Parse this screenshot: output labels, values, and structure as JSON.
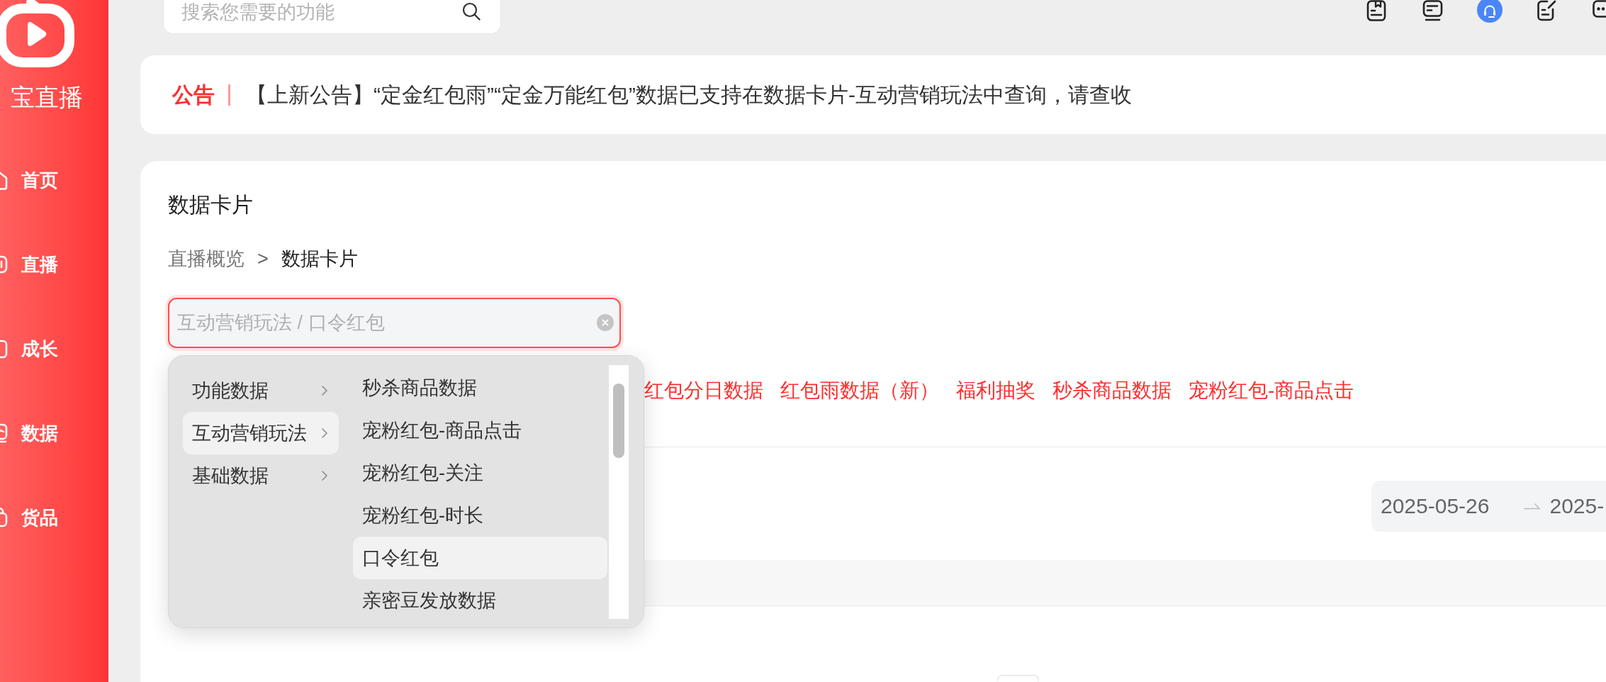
{
  "sidebar": {
    "logo_text": "宝直播",
    "items": [
      {
        "label": "首页"
      },
      {
        "label": "直播"
      },
      {
        "label": "成长"
      },
      {
        "label": "数据"
      },
      {
        "label": "货品"
      }
    ]
  },
  "search": {
    "placeholder": "搜索您需要的功能"
  },
  "notice": {
    "label": "公告",
    "text": "【上新公告】“定金红包雨”“定金万能红包”数据已支持在数据卡片-互动营销玩法中查询，请查收"
  },
  "card": {
    "title": "数据卡片",
    "breadcrumb": {
      "items": [
        "直播概览",
        "数据卡片"
      ],
      "separator": ">"
    },
    "cascader": {
      "placeholder": "互动营销玩法 / 口令红包",
      "expanded": true,
      "menu": [
        {
          "label": "功能数据",
          "selected": false
        },
        {
          "label": "互动营销玩法",
          "selected": true
        },
        {
          "label": "基础数据",
          "selected": false
        }
      ],
      "submenu": [
        {
          "label": "秒杀商品数据",
          "selected": false
        },
        {
          "label": "宠粉红包-商品点击",
          "selected": false
        },
        {
          "label": "宠粉红包-关注",
          "selected": false
        },
        {
          "label": "宠粉红包-时长",
          "selected": false
        },
        {
          "label": "口令红包",
          "selected": true
        },
        {
          "label": "亲密豆发放数据",
          "selected": false
        }
      ]
    },
    "tags": [
      "红包分日数据",
      "红包雨数据（新）",
      "福利抽奖",
      "秒杀商品数据",
      "宠粉红包-商品点击"
    ],
    "date_range": {
      "start": "2025-05-26",
      "end": "2025-"
    }
  }
}
